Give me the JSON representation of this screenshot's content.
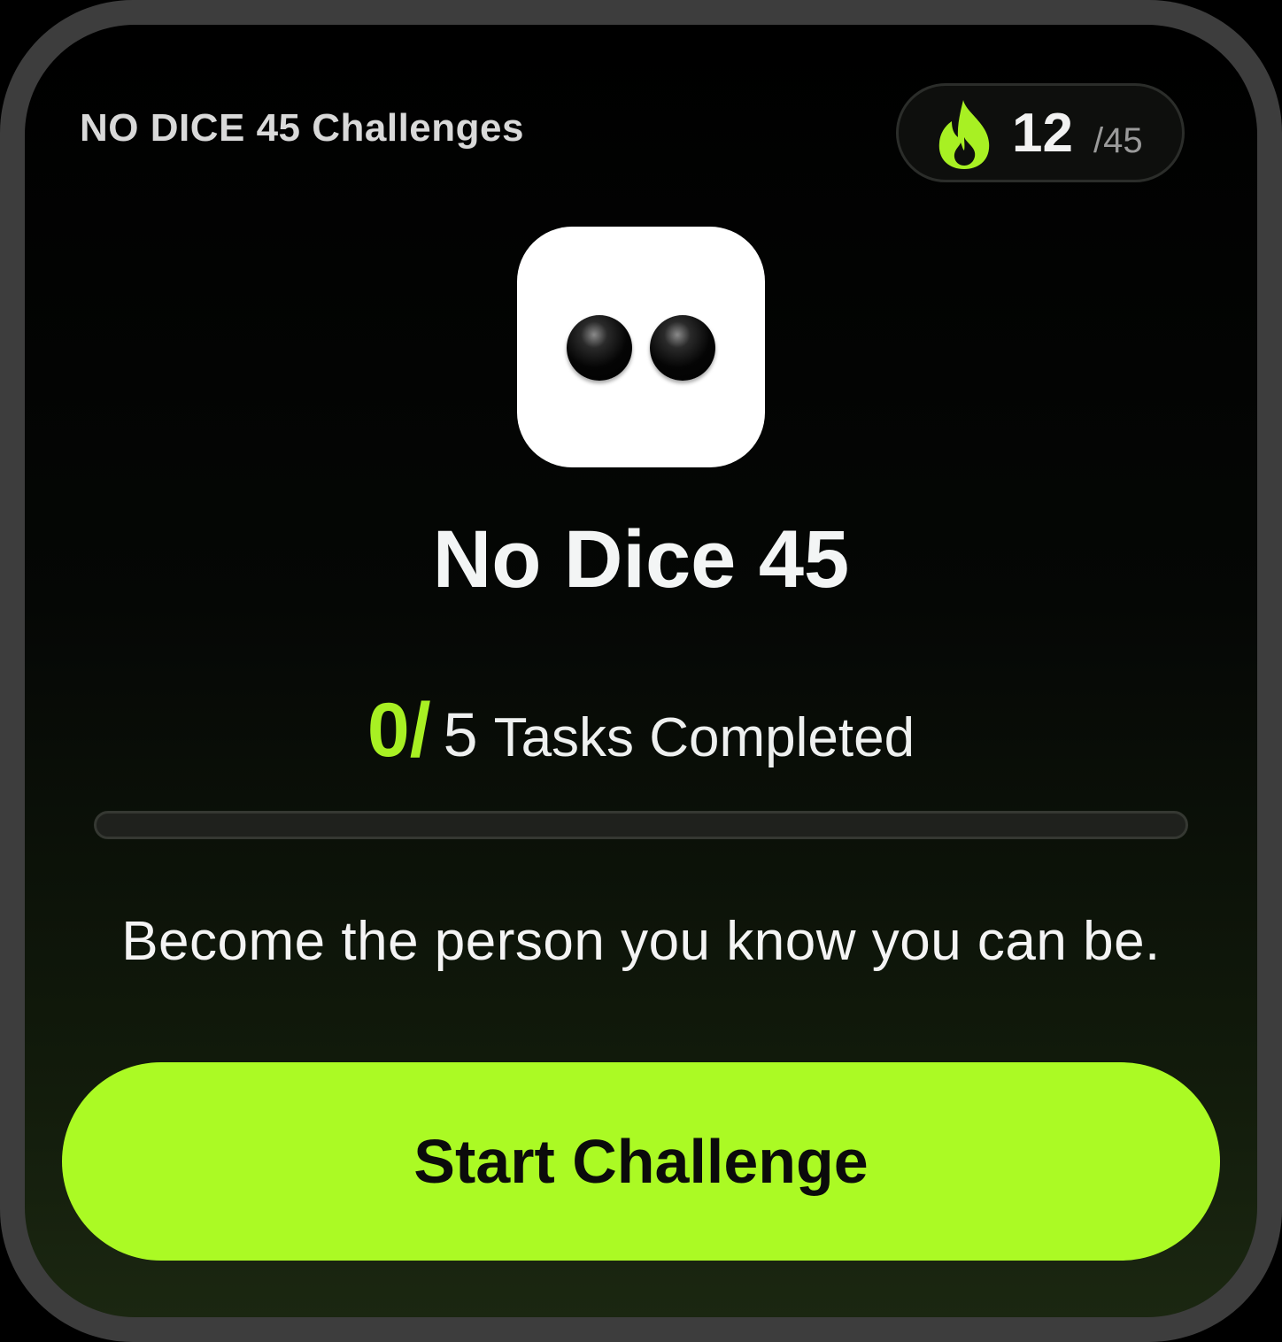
{
  "header": {
    "title": "NO DICE 45 Challenges"
  },
  "streak": {
    "icon": "flame-icon",
    "current": "12",
    "total": "/45"
  },
  "challenge": {
    "icon": "two-dots-icon",
    "title": "No Dice 45"
  },
  "progress": {
    "done": "0",
    "slash": "/",
    "total": "5",
    "label": "Tasks Completed",
    "fraction": 0
  },
  "tagline": "Become the person you know you can be.",
  "cta": {
    "label": "Start Challenge"
  },
  "colors": {
    "accent": "#abfa24",
    "background": "#000000",
    "frame": "#3d3d3d"
  }
}
